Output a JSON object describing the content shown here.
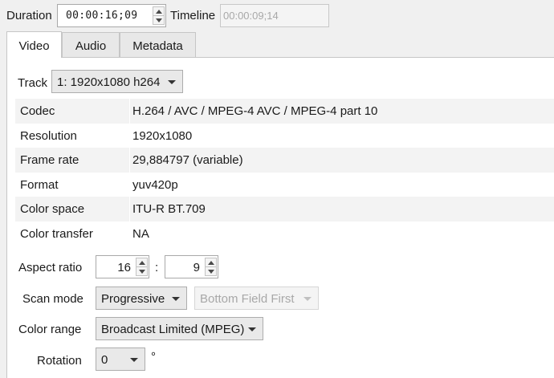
{
  "duration": {
    "label": "Duration",
    "value": "00:00:16;09"
  },
  "timeline": {
    "label": "Timeline",
    "value": "00:00:09;14"
  },
  "tabs": [
    {
      "label": "Video",
      "active": true
    },
    {
      "label": "Audio",
      "active": false
    },
    {
      "label": "Metadata",
      "active": false
    }
  ],
  "track": {
    "label": "Track",
    "value": "1: 1920x1080 h264"
  },
  "properties": [
    {
      "key": "Codec",
      "value": "H.264 / AVC / MPEG-4 AVC / MPEG-4 part 10"
    },
    {
      "key": "Resolution",
      "value": "1920x1080"
    },
    {
      "key": "Frame rate",
      "value": "29,884797 (variable)"
    },
    {
      "key": "Format",
      "value": "yuv420p"
    },
    {
      "key": "Color space",
      "value": "ITU-R BT.709"
    },
    {
      "key": "Color transfer",
      "value": "NA"
    }
  ],
  "aspect_ratio": {
    "label": "Aspect ratio",
    "num": "16",
    "sep": ":",
    "den": "9"
  },
  "scan_mode": {
    "label": "Scan mode",
    "value": "Progressive",
    "field_order": "Bottom Field First"
  },
  "color_range": {
    "label": "Color range",
    "value": "Broadcast Limited (MPEG)"
  },
  "rotation": {
    "label": "Rotation",
    "value": "0",
    "unit": "°"
  }
}
